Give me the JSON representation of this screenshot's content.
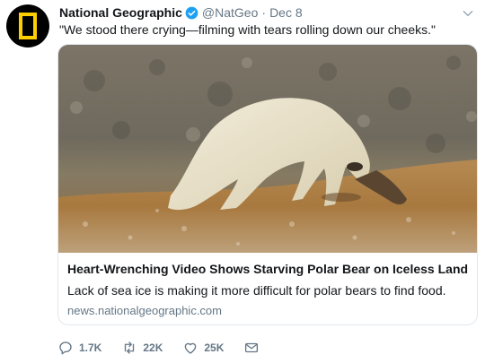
{
  "tweet": {
    "author_name": "National Geographic",
    "handle": "@NatGeo",
    "separator": "·",
    "date": "Dec 8",
    "text": "\"We stood there crying—filming with tears rolling down our cheeks.\""
  },
  "card": {
    "title": "Heart-Wrenching Video Shows Starving Polar Bear on Iceless Land",
    "description": "Lack of sea ice is making it more difficult for polar bears to find food.",
    "domain": "news.nationalgeographic.com"
  },
  "actions": {
    "replies": "1.7K",
    "retweets": "22K",
    "likes": "25K"
  },
  "icons": {
    "avatar": "natgeo-logo-icon",
    "verified": "verified-badge-icon",
    "menu": "chevron-down-icon",
    "reply": "reply-icon",
    "retweet": "retweet-icon",
    "like": "heart-icon",
    "message": "envelope-icon"
  },
  "colors": {
    "natgeo_yellow": "#ffce00",
    "verified_blue": "#1da1f2",
    "secondary_text": "#657786"
  }
}
